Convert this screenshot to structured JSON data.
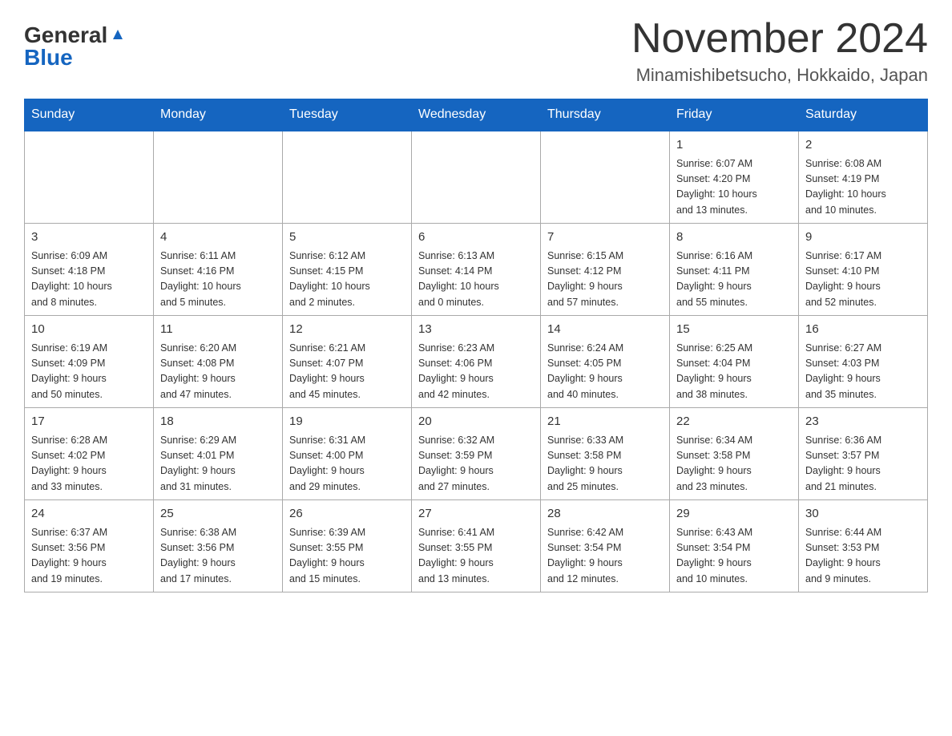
{
  "header": {
    "logo": {
      "general": "General",
      "blue": "Blue"
    },
    "title": "November 2024",
    "location": "Minamishibetsucho, Hokkaido, Japan"
  },
  "weekdays": [
    "Sunday",
    "Monday",
    "Tuesday",
    "Wednesday",
    "Thursday",
    "Friday",
    "Saturday"
  ],
  "weeks": [
    [
      {
        "day": "",
        "info": ""
      },
      {
        "day": "",
        "info": ""
      },
      {
        "day": "",
        "info": ""
      },
      {
        "day": "",
        "info": ""
      },
      {
        "day": "",
        "info": ""
      },
      {
        "day": "1",
        "info": "Sunrise: 6:07 AM\nSunset: 4:20 PM\nDaylight: 10 hours\nand 13 minutes."
      },
      {
        "day": "2",
        "info": "Sunrise: 6:08 AM\nSunset: 4:19 PM\nDaylight: 10 hours\nand 10 minutes."
      }
    ],
    [
      {
        "day": "3",
        "info": "Sunrise: 6:09 AM\nSunset: 4:18 PM\nDaylight: 10 hours\nand 8 minutes."
      },
      {
        "day": "4",
        "info": "Sunrise: 6:11 AM\nSunset: 4:16 PM\nDaylight: 10 hours\nand 5 minutes."
      },
      {
        "day": "5",
        "info": "Sunrise: 6:12 AM\nSunset: 4:15 PM\nDaylight: 10 hours\nand 2 minutes."
      },
      {
        "day": "6",
        "info": "Sunrise: 6:13 AM\nSunset: 4:14 PM\nDaylight: 10 hours\nand 0 minutes."
      },
      {
        "day": "7",
        "info": "Sunrise: 6:15 AM\nSunset: 4:12 PM\nDaylight: 9 hours\nand 57 minutes."
      },
      {
        "day": "8",
        "info": "Sunrise: 6:16 AM\nSunset: 4:11 PM\nDaylight: 9 hours\nand 55 minutes."
      },
      {
        "day": "9",
        "info": "Sunrise: 6:17 AM\nSunset: 4:10 PM\nDaylight: 9 hours\nand 52 minutes."
      }
    ],
    [
      {
        "day": "10",
        "info": "Sunrise: 6:19 AM\nSunset: 4:09 PM\nDaylight: 9 hours\nand 50 minutes."
      },
      {
        "day": "11",
        "info": "Sunrise: 6:20 AM\nSunset: 4:08 PM\nDaylight: 9 hours\nand 47 minutes."
      },
      {
        "day": "12",
        "info": "Sunrise: 6:21 AM\nSunset: 4:07 PM\nDaylight: 9 hours\nand 45 minutes."
      },
      {
        "day": "13",
        "info": "Sunrise: 6:23 AM\nSunset: 4:06 PM\nDaylight: 9 hours\nand 42 minutes."
      },
      {
        "day": "14",
        "info": "Sunrise: 6:24 AM\nSunset: 4:05 PM\nDaylight: 9 hours\nand 40 minutes."
      },
      {
        "day": "15",
        "info": "Sunrise: 6:25 AM\nSunset: 4:04 PM\nDaylight: 9 hours\nand 38 minutes."
      },
      {
        "day": "16",
        "info": "Sunrise: 6:27 AM\nSunset: 4:03 PM\nDaylight: 9 hours\nand 35 minutes."
      }
    ],
    [
      {
        "day": "17",
        "info": "Sunrise: 6:28 AM\nSunset: 4:02 PM\nDaylight: 9 hours\nand 33 minutes."
      },
      {
        "day": "18",
        "info": "Sunrise: 6:29 AM\nSunset: 4:01 PM\nDaylight: 9 hours\nand 31 minutes."
      },
      {
        "day": "19",
        "info": "Sunrise: 6:31 AM\nSunset: 4:00 PM\nDaylight: 9 hours\nand 29 minutes."
      },
      {
        "day": "20",
        "info": "Sunrise: 6:32 AM\nSunset: 3:59 PM\nDaylight: 9 hours\nand 27 minutes."
      },
      {
        "day": "21",
        "info": "Sunrise: 6:33 AM\nSunset: 3:58 PM\nDaylight: 9 hours\nand 25 minutes."
      },
      {
        "day": "22",
        "info": "Sunrise: 6:34 AM\nSunset: 3:58 PM\nDaylight: 9 hours\nand 23 minutes."
      },
      {
        "day": "23",
        "info": "Sunrise: 6:36 AM\nSunset: 3:57 PM\nDaylight: 9 hours\nand 21 minutes."
      }
    ],
    [
      {
        "day": "24",
        "info": "Sunrise: 6:37 AM\nSunset: 3:56 PM\nDaylight: 9 hours\nand 19 minutes."
      },
      {
        "day": "25",
        "info": "Sunrise: 6:38 AM\nSunset: 3:56 PM\nDaylight: 9 hours\nand 17 minutes."
      },
      {
        "day": "26",
        "info": "Sunrise: 6:39 AM\nSunset: 3:55 PM\nDaylight: 9 hours\nand 15 minutes."
      },
      {
        "day": "27",
        "info": "Sunrise: 6:41 AM\nSunset: 3:55 PM\nDaylight: 9 hours\nand 13 minutes."
      },
      {
        "day": "28",
        "info": "Sunrise: 6:42 AM\nSunset: 3:54 PM\nDaylight: 9 hours\nand 12 minutes."
      },
      {
        "day": "29",
        "info": "Sunrise: 6:43 AM\nSunset: 3:54 PM\nDaylight: 9 hours\nand 10 minutes."
      },
      {
        "day": "30",
        "info": "Sunrise: 6:44 AM\nSunset: 3:53 PM\nDaylight: 9 hours\nand 9 minutes."
      }
    ]
  ]
}
